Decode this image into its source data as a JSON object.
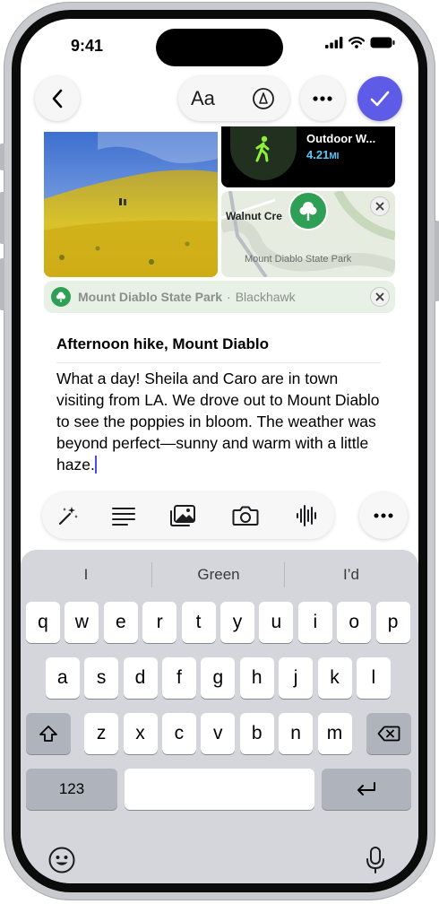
{
  "status": {
    "time": "9:41"
  },
  "toolbar": {
    "format_label": "Aa"
  },
  "workout": {
    "title": "Outdoor W...",
    "distance": "4.21",
    "unit": "MI"
  },
  "map": {
    "street": "Walnut Cre",
    "park_label": "Mount Diablo State Park"
  },
  "location": {
    "name": "Mount Diablo State Park",
    "separator": "·",
    "area": "Blackhawk"
  },
  "note": {
    "title": "Afternoon hike, Mount Diablo",
    "body": "What a day! Sheila and Caro are in town visiting from LA. We drove out to Mount Diablo to see the poppies in bloom. The weather was beyond perfect—sunny and warm with a little haze."
  },
  "keyboard": {
    "suggestions": [
      "I",
      "Green",
      "I’d"
    ],
    "row1": [
      "q",
      "w",
      "e",
      "r",
      "t",
      "y",
      "u",
      "i",
      "o",
      "p"
    ],
    "row2": [
      "a",
      "s",
      "d",
      "f",
      "g",
      "h",
      "j",
      "k",
      "l"
    ],
    "row3": [
      "z",
      "x",
      "c",
      "v",
      "b",
      "n",
      "m"
    ],
    "numbers_label": "123"
  },
  "colors": {
    "accent": "#5e5ce6",
    "park_green": "#2f9f55",
    "workout_green": "#8cf03c",
    "distance_blue": "#5ac8fa"
  }
}
